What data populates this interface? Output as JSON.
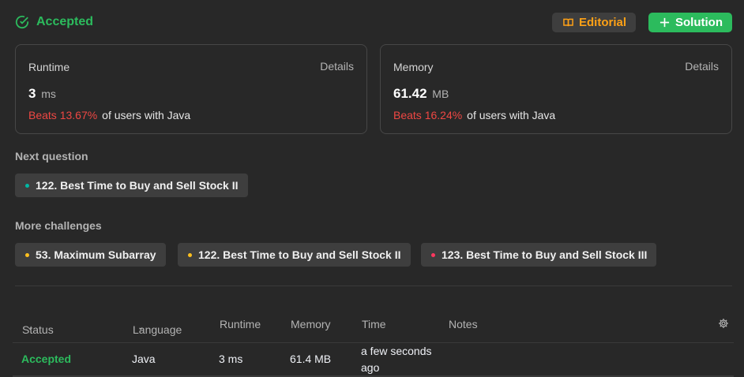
{
  "header": {
    "status": "Accepted",
    "editorial_label": "Editorial",
    "solution_label": "Solution"
  },
  "runtime": {
    "title": "Runtime",
    "details": "Details",
    "value": "3",
    "unit": "ms",
    "beats": "Beats 13.67%",
    "beats_suffix": "of users with Java"
  },
  "memory": {
    "title": "Memory",
    "details": "Details",
    "value": "61.42",
    "unit": "MB",
    "beats": "Beats 16.24%",
    "beats_suffix": "of users with Java"
  },
  "next_question": {
    "label": "Next question",
    "items": [
      {
        "title": "122. Best Time to Buy and Sell Stock II",
        "dot_color": "#00b8a3"
      }
    ]
  },
  "more_challenges": {
    "label": "More challenges",
    "items": [
      {
        "title": "53. Maximum Subarray",
        "dot_color": "#ffc01e"
      },
      {
        "title": "122. Best Time to Buy and Sell Stock II",
        "dot_color": "#ffc01e"
      },
      {
        "title": "123. Best Time to Buy and Sell Stock III",
        "dot_color": "#ff375f"
      }
    ]
  },
  "table": {
    "columns": {
      "status": "Status",
      "language": "Language",
      "runtime": "Runtime",
      "memory": "Memory",
      "time": "Time",
      "notes": "Notes"
    },
    "rows": [
      {
        "status": "Accepted",
        "language": "Java",
        "runtime": "3 ms",
        "memory": "61.4 MB",
        "time_line1": "a few seconds",
        "time_line2": "ago",
        "notes": ""
      }
    ]
  },
  "colors": {
    "accent_green": "#2cbb5d",
    "accent_orange": "#ffa116",
    "beats_red": "#ef4743",
    "background": "#282828"
  }
}
